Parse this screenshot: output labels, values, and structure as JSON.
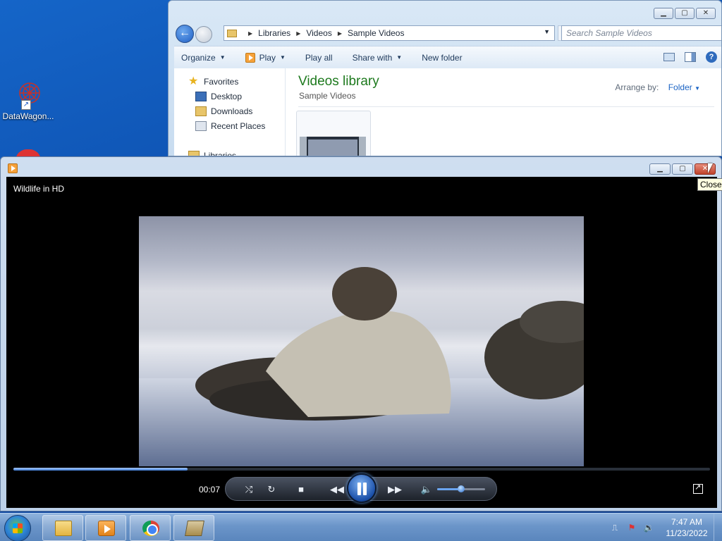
{
  "desktop": {
    "icon_label": "DataWagon...",
    "icon_name": "datawagon-icon"
  },
  "explorer": {
    "breadcrumb": [
      "Libraries",
      "Videos",
      "Sample Videos"
    ],
    "search_placeholder": "Search Sample Videos",
    "toolbar": {
      "organize": "Organize",
      "play": "Play",
      "play_all": "Play all",
      "share_with": "Share with",
      "new_folder": "New folder"
    },
    "nav": {
      "favorites": "Favorites",
      "desktop": "Desktop",
      "downloads": "Downloads",
      "recent_places": "Recent Places",
      "libraries": "Libraries"
    },
    "library_title": "Videos library",
    "library_subtitle": "Sample Videos",
    "arrange_by_label": "Arrange by:",
    "arrange_by_value": "Folder"
  },
  "player": {
    "now_playing": "Wildlife in HD",
    "elapsed": "00:07",
    "progress_fraction": 0.25,
    "volume_fraction": 0.5,
    "tooltip": "Close",
    "state": "playing"
  },
  "taskbar": {
    "apps": [
      "windows-explorer",
      "windows-media-player",
      "google-chrome",
      "network-tool"
    ],
    "time": "7:47 AM",
    "date": "11/23/2022"
  },
  "colors": {
    "library_title": "#1e7a1e",
    "link_blue": "#1a63c4",
    "player_accent": "#2d6fd0"
  }
}
